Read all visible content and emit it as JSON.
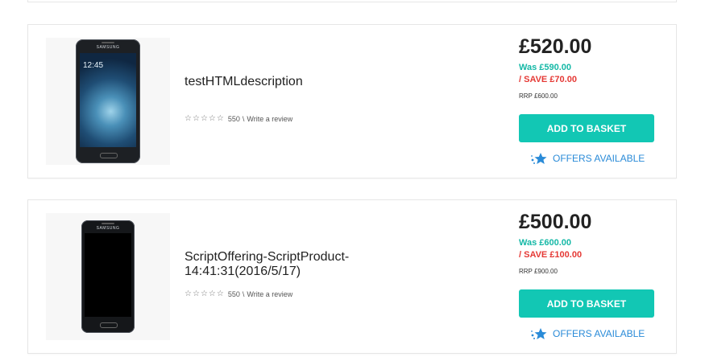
{
  "products": [
    {
      "title": "testHTMLdescription",
      "review_count": "550",
      "separator": "\\",
      "write_review": "Write a review",
      "price": "£520.00",
      "was": "Was £590.00",
      "save": "/ SAVE £70.00",
      "rrp": "RRP £600.00",
      "add_to_basket": "ADD TO BASKET",
      "offers": "OFFERS AVAILABLE",
      "phone_brand": "SAMSUNG",
      "phone_clock": "12:45"
    },
    {
      "title": "ScriptOffering-ScriptProduct-14:41:31(2016/5/17)",
      "review_count": "550",
      "separator": "\\",
      "write_review": "Write a review",
      "price": "£500.00",
      "was": "Was £600.00",
      "save": "/ SAVE £100.00",
      "rrp": "RRP £900.00",
      "add_to_basket": "ADD TO BASKET",
      "offers": "OFFERS AVAILABLE",
      "phone_brand": "SAMSUNG"
    }
  ],
  "star_glyph": "☆",
  "colors": {
    "accent": "#12c7b4",
    "was_price": "#14b8a6",
    "save_price": "#e53935",
    "offers_link": "#2a8bd8"
  },
  "icons": {
    "rating": "star-outline-icon",
    "offers": "sparkle-star-icon"
  }
}
